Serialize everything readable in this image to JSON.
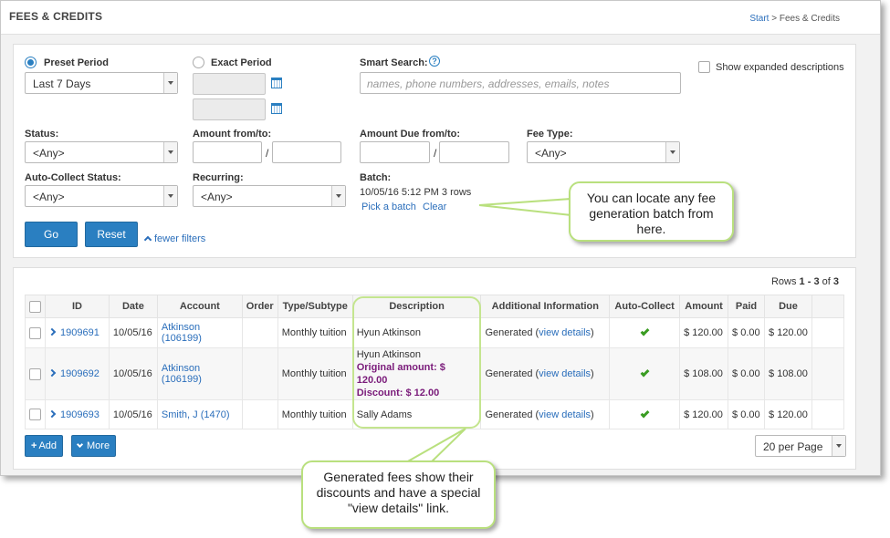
{
  "header": {
    "title": "FEES & CREDITS",
    "breadcrumb_start": "Start",
    "breadcrumb_sep": ">",
    "breadcrumb_current": "Fees & Credits"
  },
  "filters": {
    "preset_period_label": "Preset Period",
    "preset_period_value": "Last 7 Days",
    "exact_period_label": "Exact Period",
    "smart_search_label": "Smart Search:",
    "smart_search_placeholder": "names, phone numbers, addresses, emails, notes",
    "show_expanded_label": "Show expanded descriptions",
    "status_label": "Status:",
    "status_value": "<Any>",
    "amount_label": "Amount from/to:",
    "amount_sep": "/",
    "amount_due_label": "Amount Due from/to:",
    "amount_due_sep": "/",
    "fee_type_label": "Fee Type:",
    "fee_type_value": "<Any>",
    "auto_collect_label": "Auto-Collect Status:",
    "auto_collect_value": "<Any>",
    "recurring_label": "Recurring:",
    "recurring_value": "<Any>",
    "batch_label": "Batch:",
    "batch_value": "10/05/16 5:12 PM 3 rows",
    "pick_batch_link": "Pick a batch",
    "clear_link": "Clear",
    "go_button": "Go",
    "reset_button": "Reset",
    "fewer_filters_link": "fewer filters"
  },
  "results": {
    "rows_prefix": "Rows",
    "rows_range": "1 - 3",
    "rows_of": "of",
    "rows_total": "3",
    "columns": [
      "ID",
      "Date",
      "Account",
      "Order",
      "Type/Subtype",
      "Description",
      "Additional Information",
      "Auto-Collect",
      "Amount",
      "Paid",
      "Due"
    ],
    "rows": [
      {
        "id": "1909691",
        "date": "10/05/16",
        "account": "Atkinson (106199)",
        "order": "",
        "type": "Monthly tuition",
        "desc": "Hyun Atkinson",
        "desc_orig": "",
        "desc_disc": "",
        "info_prefix": "Generated (",
        "info_link": "view details",
        "info_suffix": ")",
        "amount": "$ 120.00",
        "paid": "$ 0.00",
        "due": "$ 120.00"
      },
      {
        "id": "1909692",
        "date": "10/05/16",
        "account": "Atkinson (106199)",
        "order": "",
        "type": "Monthly tuition",
        "desc": "Hyun Atkinson",
        "desc_orig": "Original amount: $ 120.00",
        "desc_disc": "Discount: $ 12.00",
        "info_prefix": "Generated (",
        "info_link": "view details",
        "info_suffix": ")",
        "amount": "$ 108.00",
        "paid": "$ 0.00",
        "due": "$ 108.00"
      },
      {
        "id": "1909693",
        "date": "10/05/16",
        "account": "Smith, J (1470)",
        "order": "",
        "type": "Monthly tuition",
        "desc": "Sally Adams",
        "desc_orig": "",
        "desc_disc": "",
        "info_prefix": "Generated (",
        "info_link": "view details",
        "info_suffix": ")",
        "amount": "$ 120.00",
        "paid": "$ 0.00",
        "due": "$ 120.00"
      }
    ],
    "add_button": "Add",
    "more_button": "More",
    "per_page_value": "20 per Page"
  },
  "callouts": {
    "batch_callout": "You can locate any fee generation batch from here.",
    "fees_callout": "Generated fees show their discounts and have a special \"view details\" link."
  },
  "colors": {
    "accent": "#2a7fc1",
    "link": "#2a6ebb",
    "discount_text": "#7a1b7a",
    "check_green": "#3a9c22",
    "callout_border": "#b9e07e"
  }
}
